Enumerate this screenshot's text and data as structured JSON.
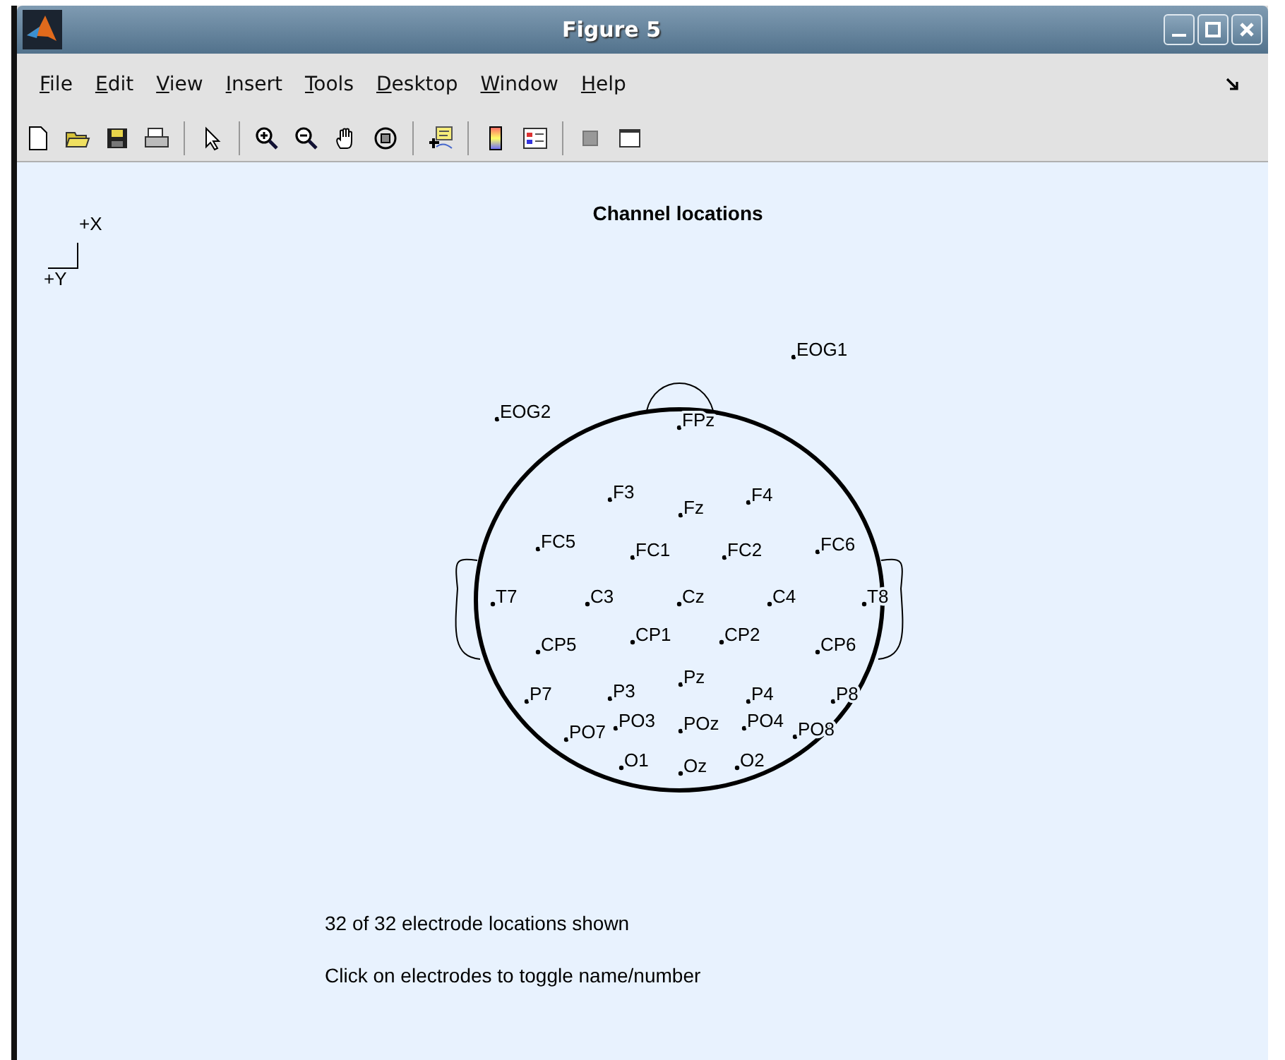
{
  "window": {
    "title": "Figure 5"
  },
  "menu": [
    {
      "label": "File"
    },
    {
      "label": "Edit"
    },
    {
      "label": "View"
    },
    {
      "label": "Insert"
    },
    {
      "label": "Tools"
    },
    {
      "label": "Desktop"
    },
    {
      "label": "Window"
    },
    {
      "label": "Help"
    }
  ],
  "plot": {
    "title": "Channel locations",
    "axis_labels": [
      "+X",
      "+Y"
    ],
    "electrodes": [
      "EOG1",
      "EOG2",
      "FPz",
      "F3",
      "Fz",
      "F4",
      "FC5",
      "FC1",
      "FC2",
      "FC6",
      "T7",
      "C3",
      "Cz",
      "C4",
      "T8",
      "CP5",
      "CP1",
      "CP2",
      "CP6",
      "P7",
      "P3",
      "Pz",
      "P4",
      "P8",
      "PO7",
      "PO3",
      "POz",
      "PO4",
      "PO8",
      "O1",
      "Oz",
      "O2"
    ],
    "notes": [
      "32 of 32 electrode locations shown",
      "Click on electrodes to toggle name/number"
    ]
  }
}
